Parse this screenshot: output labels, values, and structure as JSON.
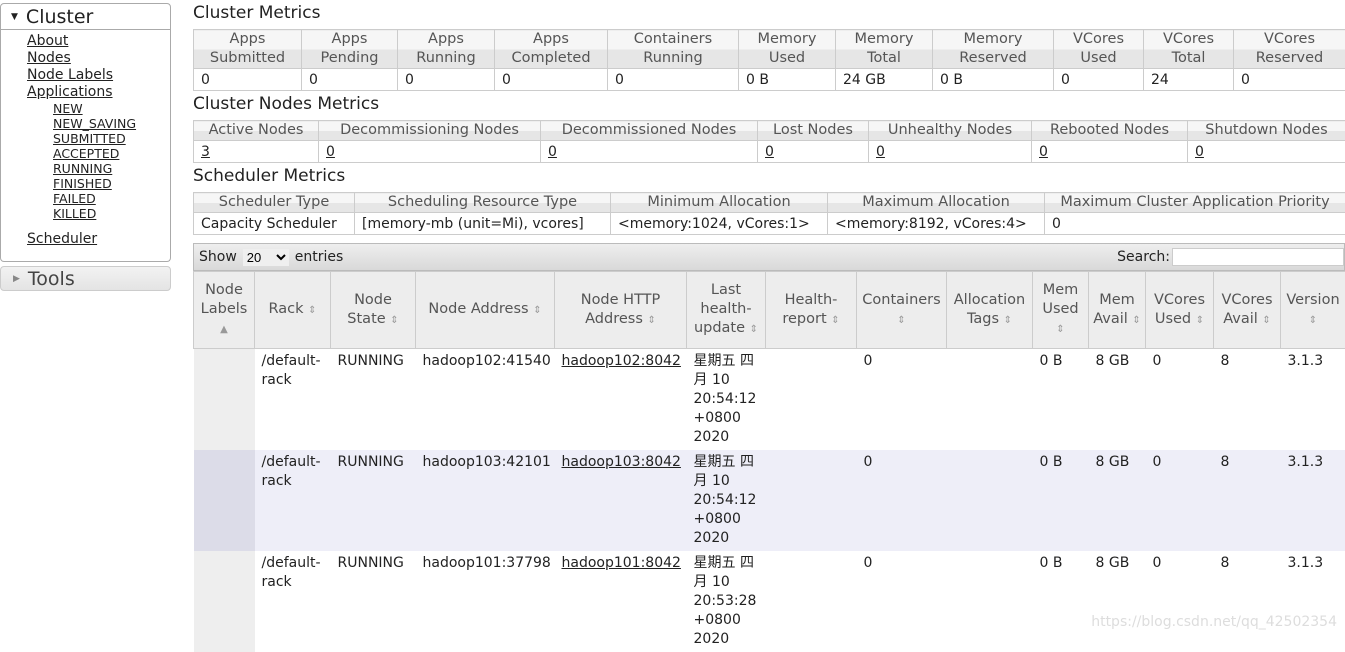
{
  "sidebar": {
    "cluster": "Cluster",
    "links": [
      "About",
      "Nodes",
      "Node Labels",
      "Applications"
    ],
    "app_states": [
      "NEW",
      "NEW_SAVING",
      "SUBMITTED",
      "ACCEPTED",
      "RUNNING",
      "FINISHED",
      "FAILED",
      "KILLED"
    ],
    "scheduler": "Scheduler",
    "tools": "Tools"
  },
  "cluster_metrics": {
    "title": "Cluster Metrics",
    "headers": [
      "Apps Submitted",
      "Apps Pending",
      "Apps Running",
      "Apps Completed",
      "Containers Running",
      "Memory Used",
      "Memory Total",
      "Memory Reserved",
      "VCores Used",
      "VCores Total",
      "VCores Reserved"
    ],
    "values": [
      "0",
      "0",
      "0",
      "0",
      "0",
      "0 B",
      "24 GB",
      "0 B",
      "0",
      "24",
      "0"
    ]
  },
  "nodes_metrics": {
    "title": "Cluster Nodes Metrics",
    "headers": [
      "Active Nodes",
      "Decommissioning Nodes",
      "Decommissioned Nodes",
      "Lost Nodes",
      "Unhealthy Nodes",
      "Rebooted Nodes",
      "Shutdown Nodes"
    ],
    "values": [
      "3",
      "0",
      "0",
      "0",
      "0",
      "0",
      "0"
    ]
  },
  "scheduler_metrics": {
    "title": "Scheduler Metrics",
    "headers": [
      "Scheduler Type",
      "Scheduling Resource Type",
      "Minimum Allocation",
      "Maximum Allocation",
      "Maximum Cluster Application Priority"
    ],
    "values": [
      "Capacity Scheduler",
      "[memory-mb (unit=Mi), vcores]",
      "<memory:1024, vCores:1>",
      "<memory:8192, vCores:4>",
      "0"
    ]
  },
  "table_controls": {
    "show": "Show",
    "entries_value": "20",
    "entries": "entries",
    "search": "Search:",
    "search_value": ""
  },
  "nodes_table": {
    "headers": [
      "Node Labels",
      "Rack",
      "Node State",
      "Node Address",
      "Node HTTP Address",
      "Last health-update",
      "Health-report",
      "Containers",
      "Allocation Tags",
      "Mem Used",
      "Mem Avail",
      "VCores Used",
      "VCores Avail",
      "Version"
    ],
    "rows": [
      [
        "",
        "/default-rack",
        "RUNNING",
        "hadoop102:41540",
        "hadoop102:8042",
        "星期五 四月 10 20:54:12 +0800 2020",
        "",
        "0",
        "",
        "0 B",
        "8 GB",
        "0",
        "8",
        "3.1.3"
      ],
      [
        "",
        "/default-rack",
        "RUNNING",
        "hadoop103:42101",
        "hadoop103:8042",
        "星期五 四月 10 20:54:12 +0800 2020",
        "",
        "0",
        "",
        "0 B",
        "8 GB",
        "0",
        "8",
        "3.1.3"
      ],
      [
        "",
        "/default-rack",
        "RUNNING",
        "hadoop101:37798",
        "hadoop101:8042",
        "星期五 四月 10 20:53:28 +0800 2020",
        "",
        "0",
        "",
        "0 B",
        "8 GB",
        "0",
        "8",
        "3.1.3"
      ]
    ]
  },
  "watermark": "https://blog.csdn.net/qq_42502354"
}
